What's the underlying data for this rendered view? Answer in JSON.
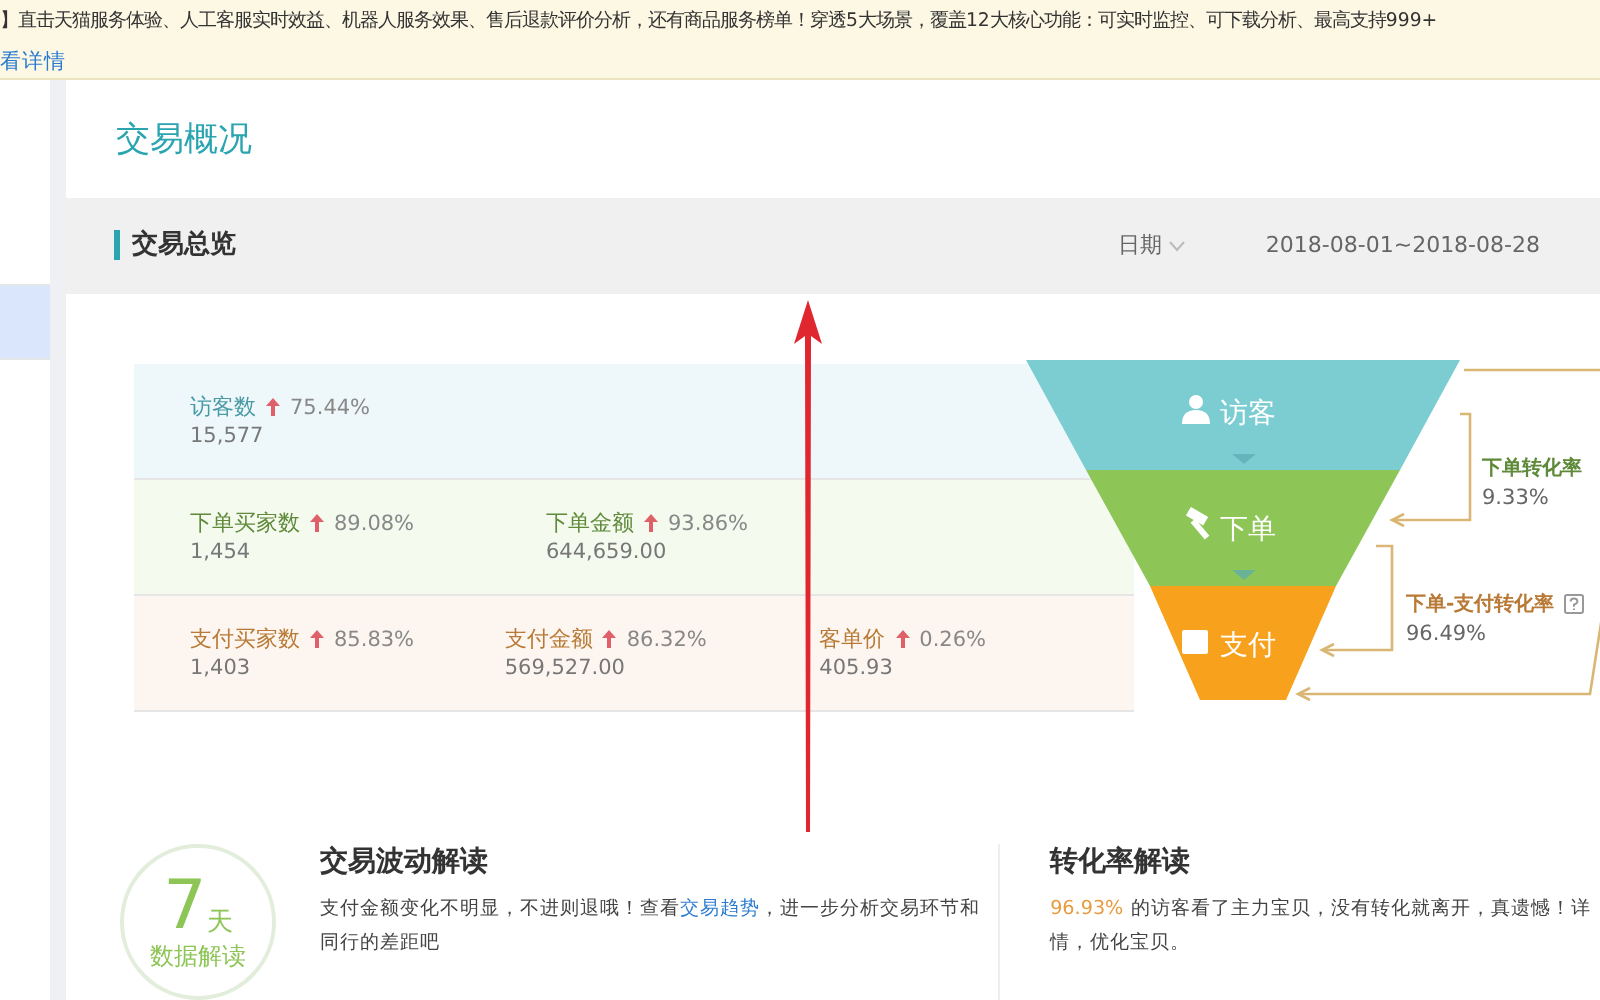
{
  "notice": {
    "text": "】直击天猫服务体验、人工客服实时效益、机器人服务效果、售后退款评价分析，还有商品服务榜单！穿透5大场景，覆盖12大核心功能：可实时监控、可下载分析、最高支持999+",
    "link": "看详情"
  },
  "sidebar": {
    "items": [
      {
        "selected": false
      },
      {
        "selected": true
      }
    ]
  },
  "page_title": "交易概况",
  "overview": {
    "title": "交易总览",
    "date_label": "日期",
    "date_range": "2018-08-01~2018-08-28",
    "rows": [
      {
        "kind": "visitor",
        "metrics": [
          {
            "label": "访客数",
            "change": "75.44%",
            "value": "15,577"
          }
        ]
      },
      {
        "kind": "order",
        "metrics": [
          {
            "label": "下单买家数",
            "change": "89.08%",
            "value": "1,454"
          },
          {
            "label": "下单金额",
            "change": "93.86%",
            "value": "644,659.00"
          }
        ]
      },
      {
        "kind": "pay",
        "metrics": [
          {
            "label": "支付买家数",
            "change": "85.83%",
            "value": "1,403"
          },
          {
            "label": "支付金额",
            "change": "86.32%",
            "value": "569,527.00"
          },
          {
            "label": "客单价",
            "change": "0.26%",
            "value": "405.93"
          }
        ]
      }
    ],
    "funnel": [
      {
        "kind": "visitor",
        "label": "访客"
      },
      {
        "kind": "order",
        "label": "下单"
      },
      {
        "kind": "pay",
        "label": "支付"
      }
    ],
    "rates": [
      {
        "kind": "order",
        "label": "下单转化率",
        "value": "9.33%",
        "help": false
      },
      {
        "kind": "pay",
        "label": "下单-支付转化率",
        "value": "96.49%",
        "help": true
      }
    ]
  },
  "insights": {
    "badge_number": "7",
    "badge_unit": "天",
    "badge_caption": "数据解读",
    "items": [
      {
        "title": "交易波动解读",
        "text_before": "支付金额变化不明显，不进则退哦！查看",
        "link": "交易趋势",
        "text_after": "，进一步分析交易环节和同行的差距吧"
      },
      {
        "title": "转化率解读",
        "highlight": "96.93%",
        "text_before": "的访客看了主力宝贝，没有转化就离开，真遗憾！",
        "text_after": "详情，优化宝贝。"
      }
    ]
  }
}
